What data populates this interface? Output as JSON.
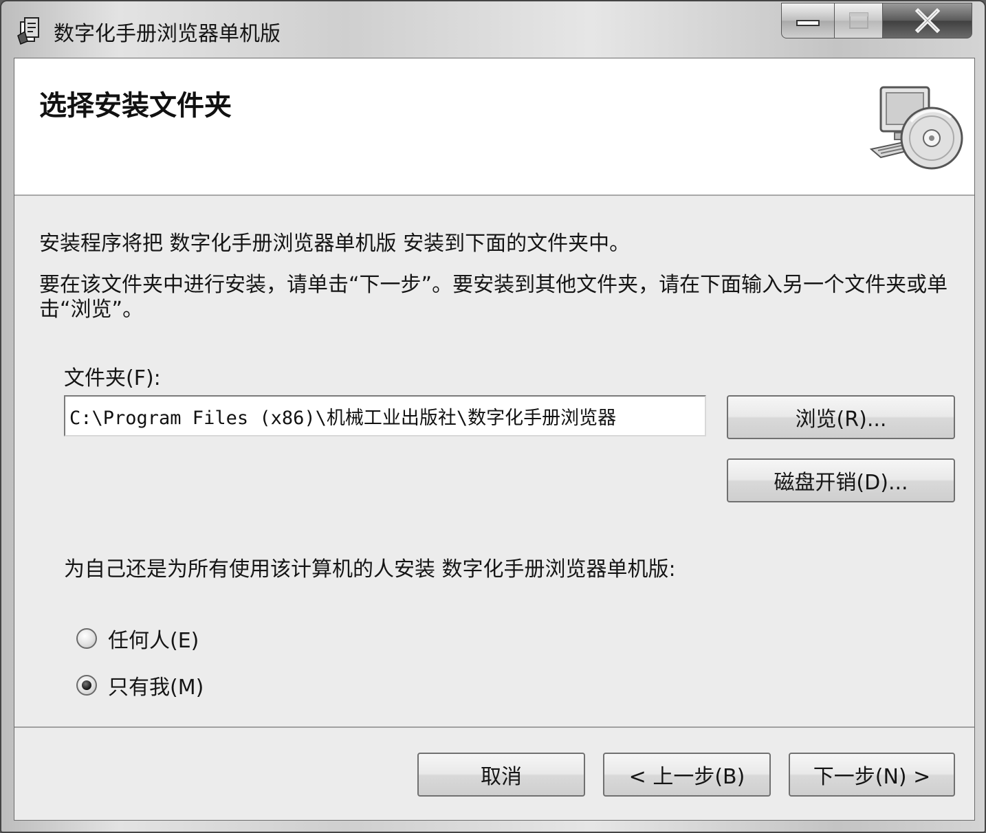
{
  "window": {
    "title": "数字化手册浏览器单机版",
    "controls": {
      "minimize": "minimize-icon",
      "maximize": "maximize-icon",
      "close": "close-icon"
    }
  },
  "banner": {
    "heading": "选择安装文件夹",
    "icon": "computer-disc-icon"
  },
  "body": {
    "intro": "安装程序将把 数字化手册浏览器单机版 安装到下面的文件夹中。",
    "instructions": "要在该文件夹中进行安装，请单击“下一步”。要安装到其他文件夹，请在下面输入另一个文件夹或单击“浏览”。"
  },
  "folder": {
    "label": "文件夹(F):",
    "value": "C:\\Program Files (x86)\\机械工业出版社\\数字化手册浏览器",
    "browse_label": "浏览(R)...",
    "disk_cost_label": "磁盘开销(D)..."
  },
  "install_for": {
    "label": "为自己还是为所有使用该计算机的人安装 数字化手册浏览器单机版:",
    "options": [
      {
        "label": "任何人(E)",
        "selected": false
      },
      {
        "label": "只有我(M)",
        "selected": true
      }
    ]
  },
  "footer": {
    "cancel_label": "取消",
    "back_label": "< 上一步(B)",
    "next_label": "下一步(N) >"
  }
}
